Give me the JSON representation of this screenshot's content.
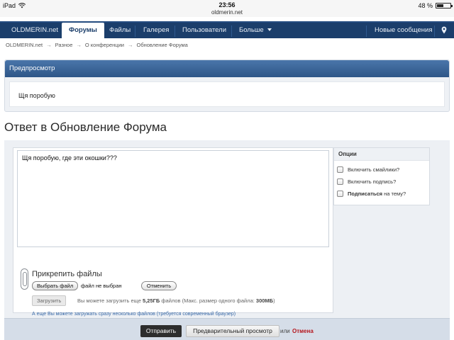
{
  "status_bar": {
    "device": "iPad",
    "time": "23:56",
    "url": "oldmerin.net",
    "battery": "48 %",
    "battery_level": 0.48
  },
  "nav": {
    "brand": "OLDMERIN.net",
    "items": [
      "Форумы",
      "Файлы",
      "Галерея",
      "Пользователи",
      "Больше"
    ],
    "new_messages": "Новые сообщения"
  },
  "breadcrumb": [
    "OLDMERIN.net",
    "Разное",
    "О конференции",
    "Обновление Форума"
  ],
  "preview": {
    "header": "Предпросмотр",
    "text": "Щя поробую"
  },
  "page_title": "Ответ в Обновление Форума",
  "editor": {
    "value": "Щя поробую, где эти окошки???"
  },
  "attachments": {
    "title": "Прикрепить файлы",
    "choose_file": "Выбрать файл",
    "no_file": "файл не выбран",
    "cancel": "Отменить",
    "upload": "Загрузить",
    "info_prefix": "Вы можете загрузить еще ",
    "info_size": "5,25ГБ",
    "info_mid": " файлов (Макс. размер одного файла: ",
    "info_max": "300МБ",
    "info_suffix": ")",
    "multi_link": "А еще Вы можете загружать сразу несколько файлов (требуется современный браузер)"
  },
  "options": {
    "title": "Опции",
    "smilies": "Включить смайлики?",
    "signature": "Включить подпись?",
    "subscribe_bold": "Подписаться",
    "subscribe_rest": " на тему?"
  },
  "submit": {
    "send": "Отправить",
    "preview": "Предварительный просмотр",
    "or": "или",
    "cancel": "Отмена"
  }
}
